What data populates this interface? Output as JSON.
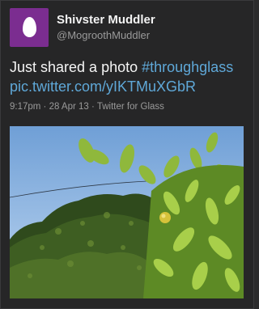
{
  "tweet": {
    "author": {
      "display_name": "Shivster Muddler",
      "screen_name": "@MogroothMuddler",
      "avatar_icon": "default-egg-icon",
      "avatar_color": "#7b2d90"
    },
    "text_plain": "Just shared a photo ",
    "hashtag": "#throughglass",
    "link": "pic.twitter.com/yIKTMuXGbR",
    "meta": "9:17pm · 28 Apr 13 · Twitter for Glass",
    "link_color": "#5fa8d8",
    "photo_icon": "attached-photo"
  }
}
